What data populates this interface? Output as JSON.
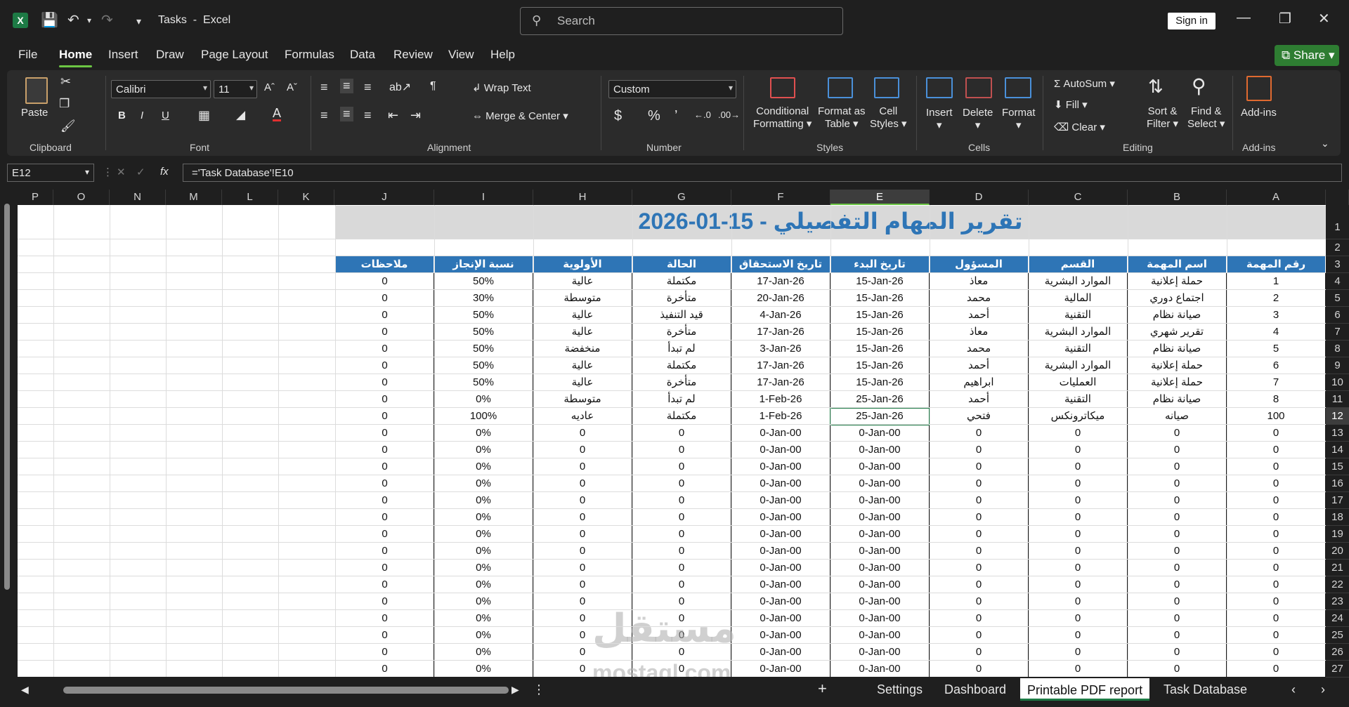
{
  "app": {
    "title": "Tasks",
    "separator": "-",
    "name": "Excel"
  },
  "search": {
    "placeholder": "Search"
  },
  "account": {
    "signin": "Sign in"
  },
  "menu_tabs": [
    "File",
    "Home",
    "Insert",
    "Draw",
    "Page Layout",
    "Formulas",
    "Data",
    "Review",
    "View",
    "Help"
  ],
  "active_tab": "Home",
  "share_label": "Share",
  "ribbon": {
    "clipboard": {
      "paste": "Paste",
      "group": "Clipboard"
    },
    "font": {
      "name": "Calibri",
      "size": "11",
      "group": "Font",
      "bold": "B",
      "italic": "I",
      "underline": "U"
    },
    "alignment": {
      "wrap": "Wrap Text",
      "merge": "Merge & Center",
      "group": "Alignment"
    },
    "number": {
      "format": "Custom",
      "group": "Number"
    },
    "styles": {
      "cond1": "Conditional",
      "cond2": "Formatting",
      "fat1": "Format as",
      "fat2": "Table",
      "cs1": "Cell",
      "cs2": "Styles",
      "group": "Styles"
    },
    "cells": {
      "insert": "Insert",
      "delete": "Delete",
      "format": "Format",
      "group": "Cells"
    },
    "editing": {
      "autosum": "AutoSum",
      "fill": "Fill",
      "clear": "Clear",
      "sort1": "Sort &",
      "sort2": "Filter",
      "find1": "Find &",
      "find2": "Select",
      "group": "Editing"
    },
    "addins": {
      "label": "Add-ins",
      "group": "Add-ins"
    }
  },
  "formula_bar": {
    "name_box": "E12",
    "formula": "='Task Database'!E10",
    "fx": "fx"
  },
  "columns_left": [
    "P",
    "O",
    "N",
    "M",
    "L",
    "K"
  ],
  "columns_right": [
    "J",
    "I",
    "H",
    "G",
    "F",
    "E",
    "D",
    "C",
    "B",
    "A"
  ],
  "selected_column": "E",
  "selected_row": "12",
  "rows": [
    "1",
    "2",
    "3",
    "4",
    "5",
    "6",
    "7",
    "8",
    "9",
    "10",
    "11",
    "12",
    "13",
    "14",
    "15",
    "16",
    "17",
    "18",
    "19",
    "20",
    "21",
    "22",
    "23",
    "24",
    "25",
    "26",
    "27"
  ],
  "report": {
    "title": "تقرير المهام التفصيلي - 15-01-2026",
    "headers": [
      "ملاحظات",
      "نسبة الإنجاز",
      "الأولوية",
      "الحالة",
      "تاريخ الاستحقاق",
      "تاريخ البدء",
      "المسؤول",
      "القسم",
      "اسم المهمة",
      "رقم المهمة"
    ],
    "data": [
      [
        "0",
        "50%",
        "عالية",
        "مكتملة",
        "17-Jan-26",
        "15-Jan-26",
        "معاذ",
        "الموارد البشرية",
        "حملة إعلانية",
        "1"
      ],
      [
        "0",
        "30%",
        "متوسطة",
        "متأخرة",
        "20-Jan-26",
        "15-Jan-26",
        "محمد",
        "المالية",
        "اجتماع دوري",
        "2"
      ],
      [
        "0",
        "50%",
        "عالية",
        "قيد التنفيذ",
        "4-Jan-26",
        "15-Jan-26",
        "أحمد",
        "التقنية",
        "صيانة نظام",
        "3"
      ],
      [
        "0",
        "50%",
        "عالية",
        "متأخرة",
        "17-Jan-26",
        "15-Jan-26",
        "معاذ",
        "الموارد البشرية",
        "تقرير شهري",
        "4"
      ],
      [
        "0",
        "50%",
        "منخفضة",
        "لم تبدأ",
        "3-Jan-26",
        "15-Jan-26",
        "محمد",
        "التقنية",
        "صيانة نظام",
        "5"
      ],
      [
        "0",
        "50%",
        "عالية",
        "مكتملة",
        "17-Jan-26",
        "15-Jan-26",
        "أحمد",
        "الموارد البشرية",
        "حملة إعلانية",
        "6"
      ],
      [
        "0",
        "50%",
        "عالية",
        "متأخرة",
        "17-Jan-26",
        "15-Jan-26",
        "ابراهيم",
        "العمليات",
        "حملة إعلانية",
        "7"
      ],
      [
        "0",
        "0%",
        "متوسطة",
        "لم تبدأ",
        "1-Feb-26",
        "25-Jan-26",
        "أحمد",
        "التقنية",
        "صيانة نظام",
        "8"
      ],
      [
        "0",
        "100%",
        "عاديه",
        "مكتملة",
        "1-Feb-26",
        "25-Jan-26",
        "فتحي",
        "ميكاترونكس",
        "صيانه",
        "100"
      ]
    ],
    "empty_row": [
      "0",
      "0%",
      "0",
      "0",
      "0-Jan-00",
      "0-Jan-00",
      "0",
      "0",
      "0",
      "0"
    ],
    "empty_count": 15
  },
  "sheet_tabs": [
    "Settings",
    "Dashboard",
    "Printable PDF report",
    "Task Database"
  ],
  "active_sheet": "Printable PDF report",
  "watermark": {
    "arabic": "مستقل",
    "latin": "mostaql.com"
  }
}
